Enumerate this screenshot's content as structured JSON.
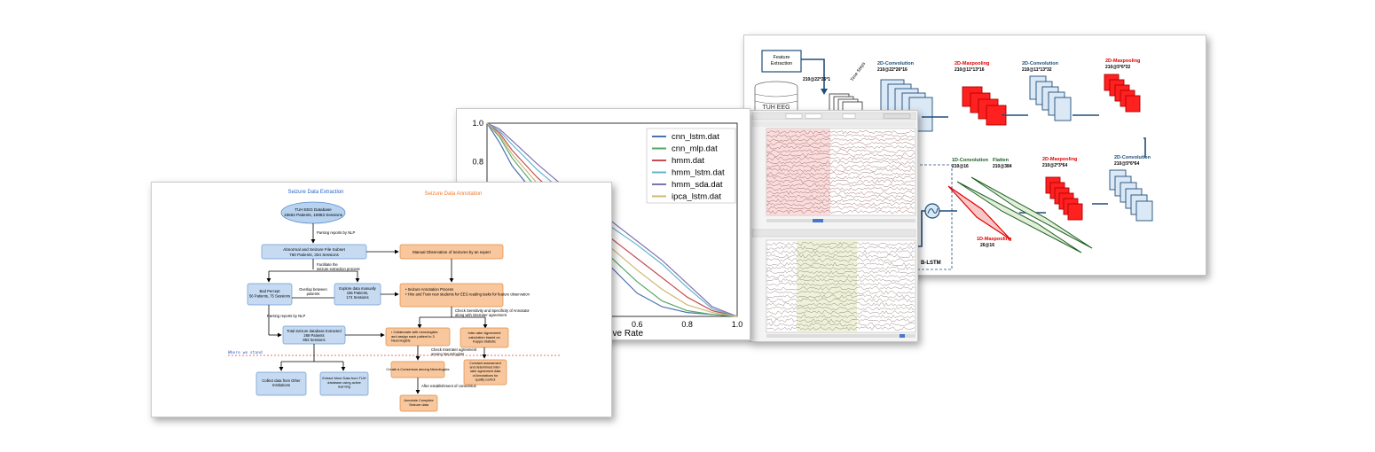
{
  "cnn_panel": {
    "feature_extraction": "Feature\nExtraction",
    "tuh_eeg": "TUH EEG",
    "input_size": "210@22*26*1",
    "time_steps": "Time Steps",
    "layers": [
      {
        "type": "2D-Convolution",
        "size": "210@22*26*16",
        "color": "#1f4e79"
      },
      {
        "type": "2D-Maxpooling",
        "size": "210@11*13*16",
        "color": "#e00000"
      },
      {
        "type": "2D-Convolution",
        "size": "210@11*13*32",
        "color": "#1f4e79"
      },
      {
        "type": "2D-Maxpooling",
        "size": "210@5*6*32",
        "color": "#e00000"
      },
      {
        "type": "2D-Convolution",
        "size": "210@5*6*64",
        "color": "#1f4e79"
      },
      {
        "type": "2D-Maxpooling",
        "size": "210@2*3*64",
        "color": "#e00000"
      },
      {
        "type": "Flatten",
        "size": "210@384",
        "color": "#1a5e20"
      },
      {
        "type": "1D-Convolution",
        "size": "210@16",
        "color": "#1a5e20"
      },
      {
        "type": "1D-Maxpooling",
        "size": "26@16",
        "color": "#e00000"
      }
    ],
    "blstm": "B-LSTM"
  },
  "chart_card": {
    "chart_data": {
      "type": "line",
      "title": "",
      "xlabel": "...itive Rate",
      "ylabel": "",
      "xlim": [
        0,
        1.0
      ],
      "ylim": [
        0,
        1.0
      ],
      "y_ticks": [
        "1.0",
        "0.8"
      ],
      "x_ticks": [
        "0.6",
        "0.8",
        "1.0"
      ],
      "legend_position": "top-right",
      "series": [
        {
          "name": "cnn_lstm.dat",
          "color": "#4c72b0",
          "x": [
            0.0,
            0.05,
            0.1,
            0.2,
            0.3,
            0.4,
            0.5,
            0.6,
            0.7,
            0.8,
            0.9,
            1.0
          ],
          "y": [
            1.0,
            0.9,
            0.78,
            0.62,
            0.5,
            0.38,
            0.25,
            0.12,
            0.05,
            0.02,
            0.01,
            0.0
          ]
        },
        {
          "name": "cnn_mlp.dat",
          "color": "#55a868",
          "x": [
            0.0,
            0.05,
            0.1,
            0.2,
            0.3,
            0.4,
            0.5,
            0.6,
            0.7,
            0.8,
            0.9,
            1.0
          ],
          "y": [
            1.0,
            0.93,
            0.82,
            0.66,
            0.54,
            0.42,
            0.3,
            0.18,
            0.08,
            0.03,
            0.01,
            0.0
          ]
        },
        {
          "name": "hmm.dat",
          "color": "#c44e52",
          "x": [
            0.0,
            0.05,
            0.1,
            0.2,
            0.3,
            0.4,
            0.5,
            0.6,
            0.7,
            0.8,
            0.9,
            1.0
          ],
          "y": [
            1.0,
            0.95,
            0.86,
            0.72,
            0.6,
            0.5,
            0.4,
            0.3,
            0.2,
            0.1,
            0.03,
            0.0
          ]
        },
        {
          "name": "hmm_lstm.dat",
          "color": "#64b5cd",
          "x": [
            0.0,
            0.05,
            0.1,
            0.2,
            0.3,
            0.4,
            0.5,
            0.6,
            0.7,
            0.8,
            0.9,
            1.0
          ],
          "y": [
            1.0,
            0.96,
            0.89,
            0.76,
            0.65,
            0.55,
            0.46,
            0.37,
            0.27,
            0.15,
            0.04,
            0.0
          ]
        },
        {
          "name": "hmm_sda.dat",
          "color": "#8172b2",
          "x": [
            0.0,
            0.05,
            0.1,
            0.2,
            0.3,
            0.4,
            0.5,
            0.6,
            0.7,
            0.8,
            0.9,
            1.0
          ],
          "y": [
            1.0,
            0.97,
            0.91,
            0.79,
            0.68,
            0.58,
            0.49,
            0.39,
            0.29,
            0.17,
            0.05,
            0.0
          ]
        },
        {
          "name": "ipca_lstm.dat",
          "color": "#ccb974",
          "x": [
            0.0,
            0.05,
            0.1,
            0.2,
            0.3,
            0.4,
            0.5,
            0.6,
            0.7,
            0.8,
            0.9,
            1.0
          ],
          "y": [
            1.0,
            0.94,
            0.84,
            0.69,
            0.57,
            0.46,
            0.35,
            0.24,
            0.14,
            0.06,
            0.02,
            0.0
          ]
        }
      ]
    }
  },
  "flow": {
    "col1_title": "Seizure Data Extraction",
    "col2_title": "Seizure Data Annotation",
    "db": "TUH EEG Database\n16664 Patients, 16983 Sessions",
    "parse1": "Parsing reports by NLP",
    "subset": "Abnormal and Seizure File Subset\n760 Patients, 334 Sessions",
    "facilitate": "Facilitate the\nseizure extraction process",
    "manual_obs": "Manual Observation of Seizures by an expert",
    "bad_percept": "Bad Percept\n56 Patients, 75 Sessions",
    "overlap": "Overlap between\npatients",
    "explore": "Explore data manually\n155 Patients,\n174 Sessions",
    "annotation_process": "• Seizure Annotation Process\n• Hire and Train new students for EEG reading tasks for feature observation",
    "check": "Check Sensitivity and Specificity of Annotator\nalong with interrater agreement",
    "parse2": "Parsing reports by NLP",
    "total": "Total Seizure database Extracted\n269 Patients\n853 Sessions",
    "collaborate": "• Collaborate with neurologists\nand assign each patient to 3\nNeurologists",
    "inter_value": "Inter-rater Agreement\ncalculation based on\nKappa Statistic",
    "check_inter": "Check Interrater agreement\namong Neurologists",
    "where": "Where we stand",
    "collect": "Collect data from Other\nInstitutions",
    "extract_more": "Extract More Data from TUH\ndatabase using active\nlearning",
    "consensus": "Create a Consensus among\nNeurologists",
    "constant": "Constant assessment\nand determined inter-\nrater agreement data\nof Annotations for\nquality control",
    "after": "After establishment of  consensus",
    "annotate": "Annotate Complete\nSeizure data"
  }
}
